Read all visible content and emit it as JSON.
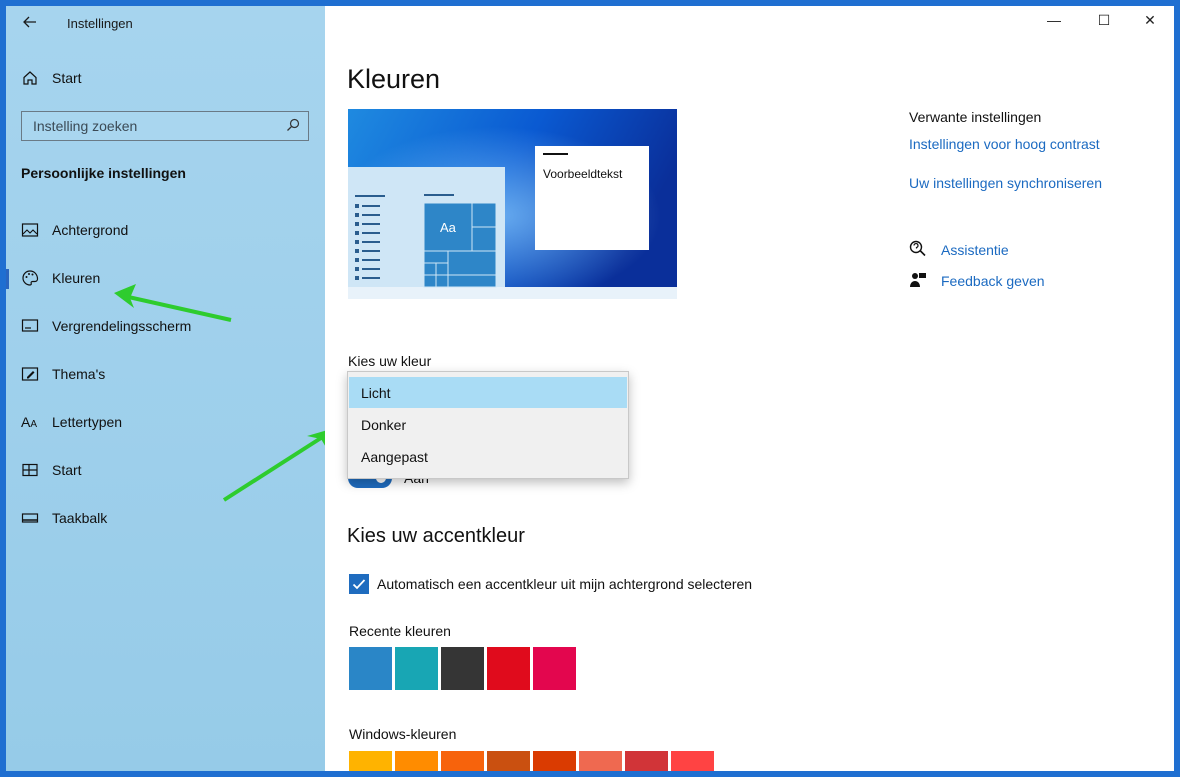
{
  "app": {
    "title": "Instellingen",
    "back_icon": "back-arrow-icon"
  },
  "window_controls": {
    "minimize": "—",
    "maximize": "☐",
    "close": "✕"
  },
  "sidebar": {
    "home_label": "Start",
    "search_placeholder": "Instelling zoeken",
    "section_title": "Persoonlijke instellingen",
    "items": [
      {
        "label": "Achtergrond",
        "icon": "image-icon"
      },
      {
        "label": "Kleuren",
        "icon": "palette-icon",
        "selected": true
      },
      {
        "label": "Vergrendelingsscherm",
        "icon": "lockscreen-icon"
      },
      {
        "label": "Thema's",
        "icon": "theme-brush-icon"
      },
      {
        "label": "Lettertypen",
        "icon": "font-icon"
      },
      {
        "label": "Start",
        "icon": "start-grid-icon"
      },
      {
        "label": "Taakbalk",
        "icon": "taskbar-icon"
      }
    ],
    "accent_color": "#2a66c0"
  },
  "main": {
    "title": "Kleuren",
    "preview": {
      "sample_text": "Voorbeeldtekst",
      "tile_label": "Aa"
    },
    "choose_color_label": "Kies uw kleur",
    "dropdown_options": [
      "Licht",
      "Donker",
      "Aangepast"
    ],
    "dropdown_highlight_color": "#a9dcf5",
    "toggle_label": "Aan",
    "accent_heading": "Kies uw accentkleur",
    "auto_accent_label": "Automatisch een accentkleur uit mijn achtergrond selecteren",
    "recent_colors_label": "Recente kleuren",
    "recent_colors": [
      "#2a86c7",
      "#18a6b4",
      "#353535",
      "#e00b1c",
      "#e3064e"
    ],
    "windows_colors_label": "Windows-kleuren",
    "windows_colors": [
      "#ffb300",
      "#ff8c00",
      "#f7630c",
      "#ca5010",
      "#da3b01",
      "#ef6950",
      "#d13438",
      "#ff4343"
    ]
  },
  "related": {
    "heading": "Verwante instellingen",
    "links": [
      "Instellingen voor hoog contrast",
      "Uw instellingen synchroniseren"
    ],
    "help": [
      {
        "label": "Assistentie",
        "icon": "chat-help-icon"
      },
      {
        "label": "Feedback geven",
        "icon": "feedback-icon"
      }
    ]
  }
}
